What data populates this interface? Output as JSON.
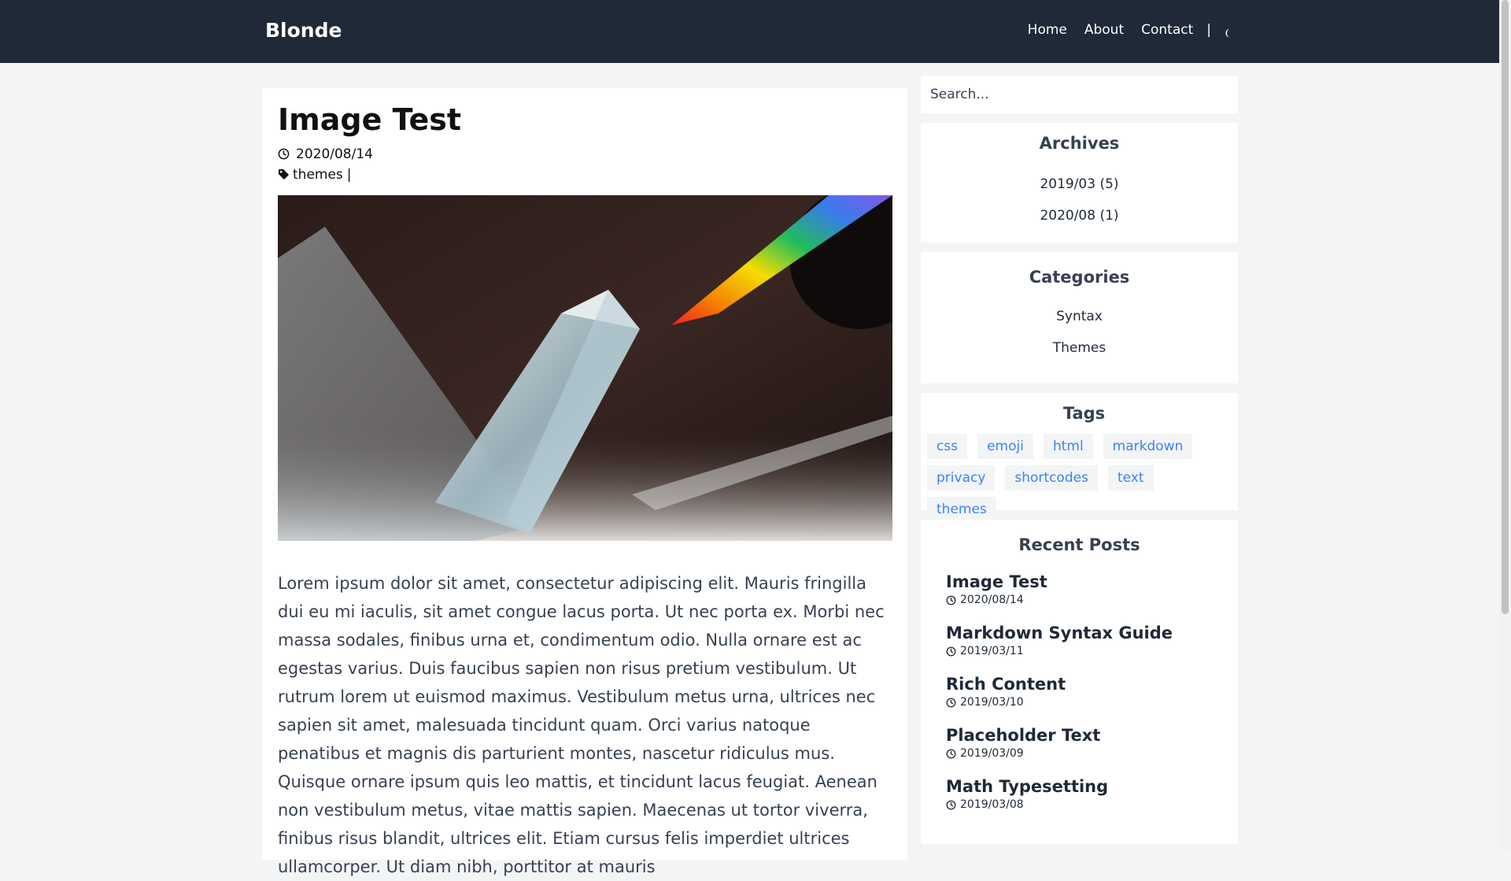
{
  "site": {
    "brand": "Blonde",
    "nav": [
      {
        "label": "Home"
      },
      {
        "label": "About"
      },
      {
        "label": "Contact"
      }
    ],
    "separator": "|",
    "theme_toggle_icon": "moon-icon"
  },
  "article": {
    "title": "Image Test",
    "date": "2020/08/14",
    "date_icon": "clock-icon",
    "tag_icon": "tag-icon",
    "tag": "themes",
    "tag_separator": "|",
    "hero_image": "prism-rainbow-photo",
    "body": "Lorem ipsum dolor sit amet, consectetur adipiscing elit. Mauris fringilla dui eu mi iaculis, sit amet congue lacus porta. Ut nec porta ex. Morbi nec massa sodales, finibus urna et, condimentum odio. Nulla ornare est ac egestas varius. Duis faucibus sapien non risus pretium vestibulum. Ut rutrum lorem ut euismod maximus. Vestibulum metus urna, ultrices nec sapien sit amet, malesuada tincidunt quam. Orci varius natoque penatibus et magnis dis parturient montes, nascetur ridiculus mus. Quisque ornare ipsum quis leo mattis, et tincidunt lacus feugiat. Aenean non vestibulum metus, vitae mattis sapien. Maecenas ut tortor viverra, finibus risus blandit, ultrices elit. Etiam cursus felis imperdiet ultrices ullamcorper. Ut diam nibh, porttitor at mauris"
  },
  "sidebar": {
    "search": {
      "placeholder": "Search..."
    },
    "archives": {
      "title": "Archives",
      "items": [
        {
          "label": "2019/03 (5)"
        },
        {
          "label": "2020/08 (1)"
        }
      ]
    },
    "categories": {
      "title": "Categories",
      "items": [
        {
          "label": "Syntax"
        },
        {
          "label": "Themes"
        }
      ]
    },
    "tags": {
      "title": "Tags",
      "items": [
        {
          "label": "css"
        },
        {
          "label": "emoji"
        },
        {
          "label": "html"
        },
        {
          "label": "markdown"
        },
        {
          "label": "privacy"
        },
        {
          "label": "shortcodes"
        },
        {
          "label": "text"
        },
        {
          "label": "themes"
        }
      ]
    },
    "recent_posts": {
      "title": "Recent Posts",
      "items": [
        {
          "title": "Image Test",
          "date": "2020/08/14"
        },
        {
          "title": "Markdown Syntax Guide",
          "date": "2019/03/11"
        },
        {
          "title": "Rich Content",
          "date": "2019/03/10"
        },
        {
          "title": "Placeholder Text",
          "date": "2019/03/09"
        },
        {
          "title": "Math Typesetting",
          "date": "2019/03/08"
        }
      ]
    }
  },
  "colors": {
    "header_bg": "#1f2937",
    "page_bg": "#f3f4f6",
    "tag_text": "#3b82f6"
  }
}
